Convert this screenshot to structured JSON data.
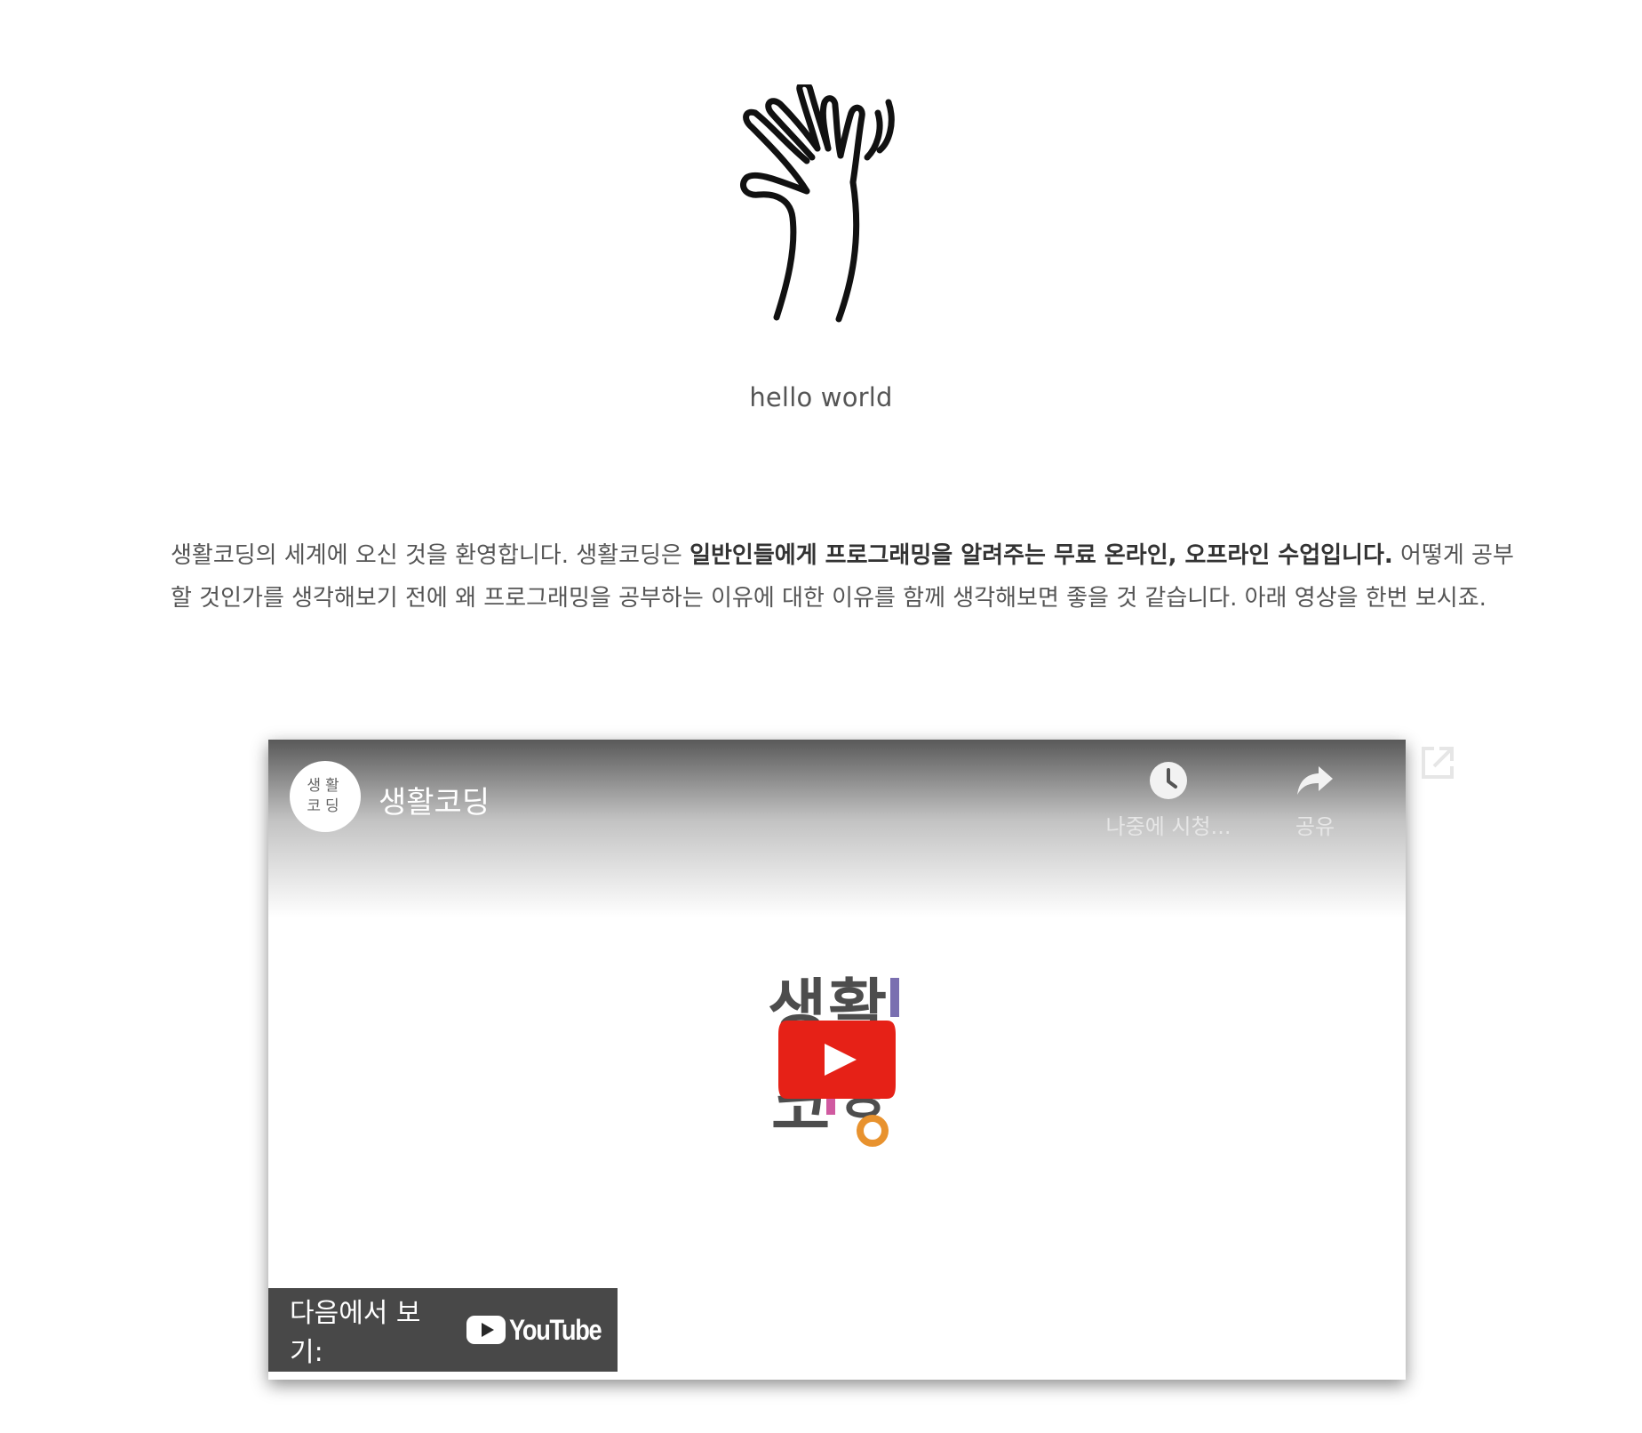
{
  "hero": {
    "icon": "waving-hand-icon",
    "caption": "hello world"
  },
  "intro": {
    "text_before": "생활코딩의 세계에 오신 것을 환영합니다. 생활코딩은 ",
    "text_bold": "일반인들에게 프로그래밍을 알려주는 무료 온라인, 오프라인 수업입니다.",
    "text_after": "  어떻게 공부할 것인가를 생각해보기 전에 왜 프로그래밍을 공부하는 이유에 대한 이유를 함께 생각해보면 좋을 것 같습니다. 아래 영상을 한번 보시죠."
  },
  "video": {
    "channel_avatar_text": "생활 코딩",
    "channel_title": "생활코딩",
    "watch_later_label": "나중에 시청...",
    "share_label": "공유",
    "center_logo_text": "생활 코딩",
    "watch_on_label": "다음에서 보기:",
    "youtube_wordmark": "YouTube",
    "colors": {
      "play_red": "#e62117",
      "logo_gray": "#4d4d4d",
      "logo_purple": "#7a6fb0",
      "logo_pink": "#d05aa0",
      "logo_orange": "#e8922e"
    }
  }
}
